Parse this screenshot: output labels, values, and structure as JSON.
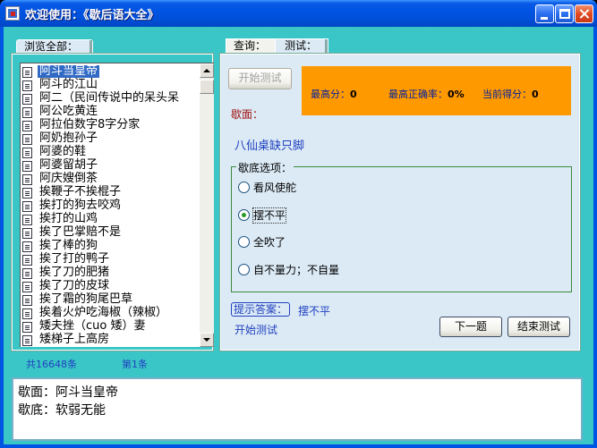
{
  "window": {
    "title": "欢迎使用：《歇后语大全》"
  },
  "browse": {
    "tab_label": "浏览全部：",
    "items": [
      "阿斗当皇帝",
      "阿斗的江山",
      "阿二（民间传说中的呆头呆",
      "阿公吃黄连",
      "阿拉伯数字8字分家",
      "阿奶抱孙子",
      "阿婆的鞋",
      "阿婆留胡子",
      "阿庆嫂倒茶",
      "挨鞭子不挨棍子",
      "挨打的狗去咬鸡",
      "挨打的山鸡",
      "挨了巴掌赔不是",
      "挨了棒的狗",
      "挨了打的鸭子",
      "挨了刀的肥猪",
      "挨了刀的皮球",
      "挨了霜的狗尾巴草",
      "挨着火炉吃海椒（辣椒）",
      "矮夫挫（cuo 矮）妻",
      "矮梯子上高房"
    ],
    "total": "共16648条",
    "page": "第1条"
  },
  "tabs": {
    "query": "查询：",
    "test": "测试："
  },
  "test": {
    "start_button": "开始测试",
    "max_score_label": "最高分：",
    "max_score": "0",
    "max_accuracy_label": "最高正确率：",
    "max_accuracy": "0%",
    "current_score_label": "当前得分：",
    "current_score": "0",
    "question_label": "歇面：",
    "question": "八仙桌缺只脚",
    "options_title": "歇底选项：",
    "options": [
      "看风使舵",
      "摆不平",
      "全吹了",
      "自不量力；不自量"
    ],
    "hint_button": "提示答案：",
    "hint_answer": "摆不平",
    "status": "开始测试",
    "next_button": "下一题",
    "end_button": "结束测试"
  },
  "detail": {
    "line1": "歇面：阿斗当皇帝",
    "line2": "歇底：软弱无能"
  }
}
